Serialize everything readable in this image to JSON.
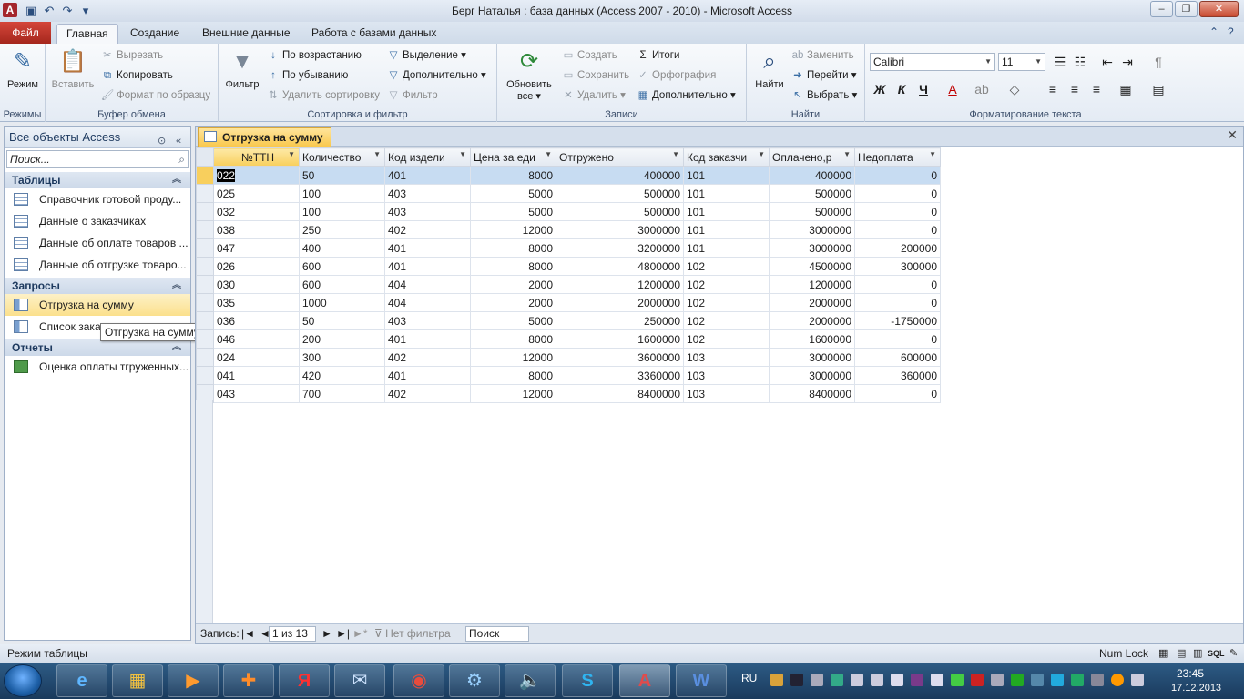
{
  "window": {
    "title": "Берг Наталья : база данных (Access 2007 - 2010)  -  Microsoft Access",
    "app_letter": "A"
  },
  "ribbon_tabs": [
    "Файл",
    "Главная",
    "Создание",
    "Внешние данные",
    "Работа с базами данных"
  ],
  "ribbon": {
    "views": {
      "mode_label": "Режим",
      "group": "Режимы"
    },
    "clipboard": {
      "paste": "Вставить",
      "cut": "Вырезать",
      "copy": "Копировать",
      "format_painter": "Формат по образцу",
      "group": "Буфер обмена"
    },
    "sort_filter": {
      "filter": "Фильтр",
      "asc": "По возрастанию",
      "desc": "По убыванию",
      "remove_sort": "Удалить сортировку",
      "selection": "Выделение",
      "advanced": "Дополнительно",
      "toggle_filter": "Фильтр",
      "group": "Сортировка и фильтр"
    },
    "records": {
      "refresh": "Обновить",
      "refresh2": "все",
      "new": "Создать",
      "save": "Сохранить",
      "delete": "Удалить",
      "totals": "Итоги",
      "spelling": "Орфография",
      "more": "Дополнительно",
      "group": "Записи"
    },
    "find": {
      "find": "Найти",
      "replace": "Заменить",
      "goto": "Перейти",
      "select": "Выбрать",
      "group": "Найти"
    },
    "text_format": {
      "font": "Calibri",
      "size": "11",
      "bold": "Ж",
      "italic": "К",
      "underline": "Ч",
      "group": "Форматирование текста"
    }
  },
  "nav_pane": {
    "title": "Все объекты Access",
    "search_placeholder": "Поиск...",
    "categories": [
      {
        "name": "Таблицы",
        "items": [
          "Справочник готовой проду...",
          "Данные о заказчиках",
          "Данные об оплате товаров ...",
          "Данные об отгрузке товаро..."
        ]
      },
      {
        "name": "Запросы",
        "items": [
          "Отгрузка на сумму",
          "Список заказ"
        ]
      },
      {
        "name": "Отчеты",
        "items": [
          "Оценка оплаты тгруженных..."
        ]
      }
    ],
    "tooltip": "Отгрузка на сумму"
  },
  "document": {
    "tab_label": "Отгрузка на сумму",
    "columns": [
      "№ТТН",
      "Количество",
      "Код издели",
      "Цена за еди",
      "Отгружено",
      "Код заказчи",
      "Оплачено,р",
      "Недоплата"
    ],
    "rows": [
      [
        "022",
        "50",
        "401",
        "8000",
        "400000",
        "101",
        "400000",
        "0"
      ],
      [
        "025",
        "100",
        "403",
        "5000",
        "500000",
        "101",
        "500000",
        "0"
      ],
      [
        "032",
        "100",
        "403",
        "5000",
        "500000",
        "101",
        "500000",
        "0"
      ],
      [
        "038",
        "250",
        "402",
        "12000",
        "3000000",
        "101",
        "3000000",
        "0"
      ],
      [
        "047",
        "400",
        "401",
        "8000",
        "3200000",
        "101",
        "3000000",
        "200000"
      ],
      [
        "026",
        "600",
        "401",
        "8000",
        "4800000",
        "102",
        "4500000",
        "300000"
      ],
      [
        "030",
        "600",
        "404",
        "2000",
        "1200000",
        "102",
        "1200000",
        "0"
      ],
      [
        "035",
        "1000",
        "404",
        "2000",
        "2000000",
        "102",
        "2000000",
        "0"
      ],
      [
        "036",
        "50",
        "403",
        "5000",
        "250000",
        "102",
        "2000000",
        "-1750000"
      ],
      [
        "046",
        "200",
        "401",
        "8000",
        "1600000",
        "102",
        "1600000",
        "0"
      ],
      [
        "024",
        "300",
        "402",
        "12000",
        "3600000",
        "103",
        "3000000",
        "600000"
      ],
      [
        "041",
        "420",
        "401",
        "8000",
        "3360000",
        "103",
        "3000000",
        "360000"
      ],
      [
        "043",
        "700",
        "402",
        "12000",
        "8400000",
        "103",
        "8400000",
        "0"
      ]
    ]
  },
  "record_nav": {
    "label": "Запись:",
    "position": "1 из 13",
    "filter": "Нет фильтра",
    "search": "Поиск"
  },
  "status": {
    "left": "Режим таблицы",
    "numlock": "Num Lock"
  },
  "taskbar": {
    "lang": "RU",
    "time": "23:45",
    "date": "17.12.2013"
  }
}
